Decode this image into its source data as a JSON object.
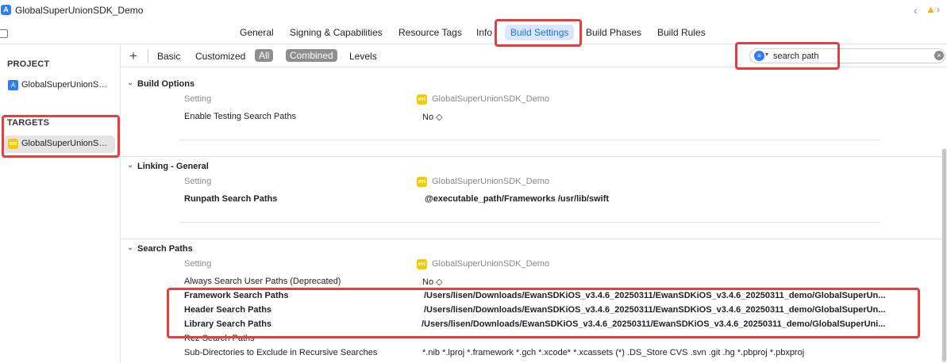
{
  "window": {
    "title": "GlobalSuperUnionSDK_Demo"
  },
  "tabs": [
    {
      "label": "General"
    },
    {
      "label": "Signing & Capabilities"
    },
    {
      "label": "Resource Tags"
    },
    {
      "label": "Info"
    },
    {
      "label": "Build Settings",
      "active": true
    },
    {
      "label": "Build Phases"
    },
    {
      "label": "Build Rules"
    }
  ],
  "sidebar": {
    "project_header": "PROJECT",
    "project_item": "GlobalSuperUnionSDK_Demo",
    "targets_header": "TARGETS",
    "target_item": "GlobalSuperUnionSDK_Demo"
  },
  "filterbar": {
    "add": "+",
    "basic": "Basic",
    "customized": "Customized",
    "all": "All",
    "combined": "Combined",
    "levels": "Levels",
    "search_value": "search path"
  },
  "sections": {
    "build_options": {
      "title": "Build Options",
      "header_setting": "Setting",
      "header_target": "GlobalSuperUnionSDK_Demo",
      "rows": [
        {
          "name": "Enable Testing Search Paths",
          "value": "No ◇"
        }
      ]
    },
    "linking": {
      "title": "Linking - General",
      "header_setting": "Setting",
      "header_target": "GlobalSuperUnionSDK_Demo",
      "rows": [
        {
          "name": "Runpath Search Paths",
          "value": "@executable_path/Frameworks /usr/lib/swift"
        }
      ]
    },
    "search_paths": {
      "title": "Search Paths",
      "header_setting": "Setting",
      "header_target": "GlobalSuperUnionSDK_Demo",
      "rows": [
        {
          "name": "Always Search User Paths (Deprecated)",
          "value": "No ◇"
        },
        {
          "name": "Framework Search Paths",
          "value": "/Users/lisen/Downloads/EwanSDKiOS_v3.4.6_20250311/EwanSDKiOS_v3.4.6_20250311_demo/GlobalSuperUn..."
        },
        {
          "name": "Header Search Paths",
          "value": "/Users/lisen/Downloads/EwanSDKiOS_v3.4.6_20250311/EwanSDKiOS_v3.4.6_20250311_demo/GlobalSuperUn..."
        },
        {
          "name": "Library Search Paths",
          "value": "/Users/lisen/Downloads/EwanSDKiOS_v3.4.6_20250311/EwanSDKiOS_v3.4.6_20250311_demo/GlobalSuperUni..."
        },
        {
          "name": "Rez Search Paths",
          "value": ""
        },
        {
          "name": "Sub-Directories to Exclude in Recursive Searches",
          "value": "*.nib *.lproj *.framework *.gch *.xcode* *.xcassets (*) .DS_Store CVS .svn .git .hg *.pbproj *.pbxproj"
        }
      ]
    }
  },
  "colors": {
    "accent": "#1a73e8",
    "highlight": "#e04040",
    "target_icon": "#f6c900"
  }
}
